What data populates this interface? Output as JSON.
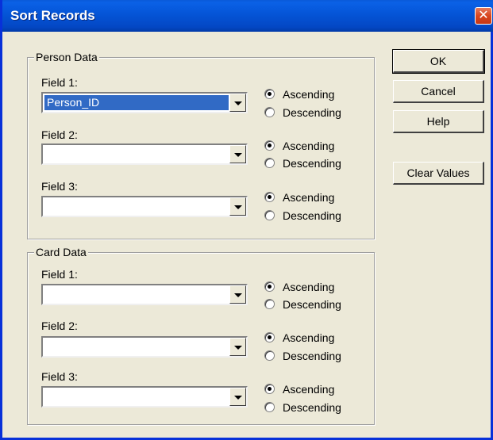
{
  "window": {
    "title": "Sort Records",
    "close_glyph": "✕"
  },
  "groups": [
    {
      "title": "Person Data",
      "fields": [
        {
          "label": "Field 1:",
          "value": "Person_ID",
          "sort": "Ascending"
        },
        {
          "label": "Field 2:",
          "value": "",
          "sort": "Ascending"
        },
        {
          "label": "Field 3:",
          "value": "",
          "sort": "Ascending"
        }
      ]
    },
    {
      "title": "Card Data",
      "fields": [
        {
          "label": "Field 1:",
          "value": "",
          "sort": "Ascending"
        },
        {
          "label": "Field 2:",
          "value": "",
          "sort": "Ascending"
        },
        {
          "label": "Field 3:",
          "value": "",
          "sort": "Ascending"
        }
      ]
    }
  ],
  "radio": {
    "ascending": "Ascending",
    "descending": "Descending"
  },
  "buttons": {
    "ok": "OK",
    "cancel": "Cancel",
    "help": "Help",
    "clear": "Clear Values"
  },
  "icons": {
    "close": "close-icon",
    "dropdown": "chevron-down-icon"
  },
  "colors": {
    "titlebar": "#0556d9",
    "close": "#d9461f",
    "selection": "#316ac5",
    "face": "#ece9d8"
  }
}
